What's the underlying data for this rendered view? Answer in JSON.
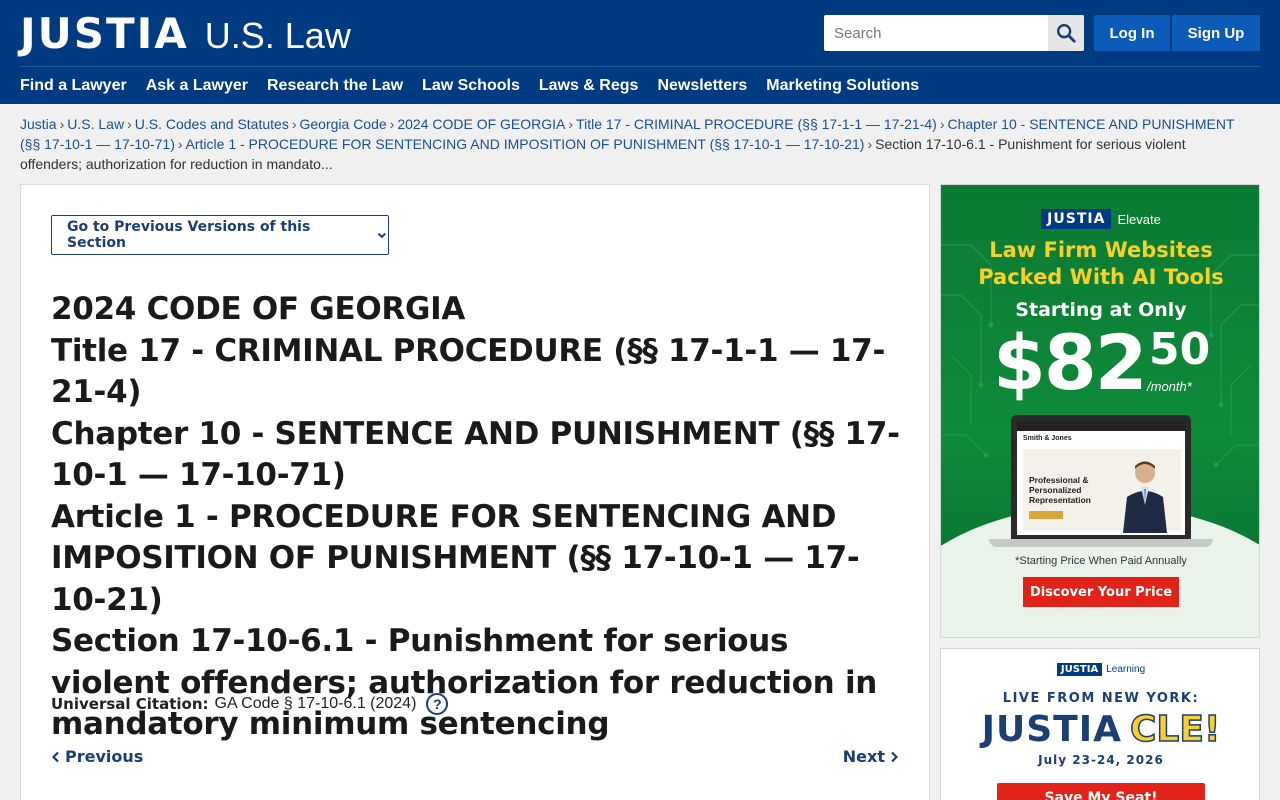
{
  "header": {
    "logo_brand": "JUSTIA",
    "logo_section": "U.S. Law",
    "search": {
      "placeholder": "Search"
    },
    "login_label": "Log In",
    "signup_label": "Sign Up",
    "nav": [
      "Find a Lawyer",
      "Ask a Lawyer",
      "Research the Law",
      "Law Schools",
      "Laws & Regs",
      "Newsletters",
      "Marketing Solutions"
    ]
  },
  "breadcrumb": {
    "items": [
      "Justia",
      "U.S. Law",
      "U.S. Codes and Statutes",
      "Georgia Code",
      "2024 CODE OF GEORGIA",
      "Title 17 - CRIMINAL PROCEDURE (§§ 17-1-1 — 17-21-4)",
      "Chapter 10 - SENTENCE AND PUNISHMENT (§§ 17-10-1 — 17-10-71)",
      "Article 1 - PROCEDURE FOR SENTENCING AND IMPOSITION OF PUNISHMENT (§§ 17-10-1 — 17-10-21)"
    ],
    "current": "Section 17-10-6.1 - Punishment for serious violent offenders; authorization for reduction in mandato..."
  },
  "main": {
    "prev_versions_label": "Go to Previous Versions of this Section",
    "heading": {
      "code": "2024 CODE OF GEORGIA",
      "title": "Title 17 - CRIMINAL PROCEDURE (§§ 17-1-1 — 17-21-4)",
      "chapter": "Chapter 10 - SENTENCE AND PUNISHMENT (§§ 17-10-1 — 17-10-71)",
      "article": "Article 1 - PROCEDURE FOR SENTENCING AND IMPOSITION OF PUNISHMENT (§§ 17-10-1 — 17-10-21)",
      "section": "Section 17-10-6.1 - Punishment for serious violent offenders; authorization for reduction in mandatory minimum sentencing"
    },
    "citation_label": "Universal Citation:",
    "citation_value": "GA Code § 17-10-6.1 (2024)",
    "help_glyph": "?",
    "previous_label": "Previous",
    "next_label": "Next"
  },
  "ad_elevate": {
    "brand": "JUSTIA",
    "product": "Elevate",
    "headline_1": "Law Firm Websites",
    "headline_2": "Packed With AI Tools",
    "starting": "Starting at Only",
    "price_dollars": "$82",
    "price_cents": "50",
    "per": "/month*",
    "mock_firm": "Smith & Jones",
    "mock_text": "Professional & Personalized Representation",
    "note": "*Starting Price When Paid Annually",
    "cta": "Discover Your Price"
  },
  "ad_cle": {
    "brand": "JUSTIA",
    "product": "Learning",
    "live": "LIVE FROM NEW YORK:",
    "title_brand": "JUSTIA",
    "title_cle": "CLE!",
    "date": "July 23-24, 2026",
    "cta": "Save My Seat!"
  },
  "colors": {
    "header_bg": "#003a80",
    "button_blue": "#0d5bb8",
    "link": "#1d4f94",
    "ad_green": "#0e8a3a",
    "ad_yellow": "#f7d02c",
    "cta_red": "#e2231a"
  }
}
